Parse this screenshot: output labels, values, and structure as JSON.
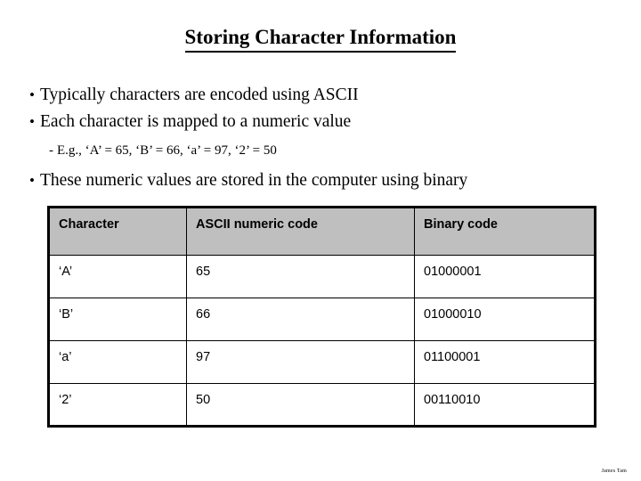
{
  "slide": {
    "title": "Storing Character Information",
    "bullets": [
      {
        "marker": "•",
        "text": "Typically characters are encoded using ASCII"
      },
      {
        "marker": "•",
        "text": "Each character is mapped to a numeric value"
      }
    ],
    "sub_bullet": {
      "marker": "-",
      "text": "E.g., ‘A’ = 65, ‘B’ = 66, ‘a’ = 97, ‘2’ = 50"
    },
    "bullet_third": {
      "marker": "•",
      "text": "These numeric values are stored in the computer using binary"
    },
    "table": {
      "headers": [
        "Character",
        "ASCII numeric code",
        "Binary code"
      ],
      "rows": [
        [
          "‘A’",
          "65",
          "01000001"
        ],
        [
          "‘B’",
          "66",
          "01000010"
        ],
        [
          "‘a’",
          "97",
          "01100001"
        ],
        [
          "‘2’",
          "50",
          "00110010"
        ]
      ],
      "header_bg": "#bfbfbf",
      "border_color": "#000000"
    },
    "footer_credit": "James Tam"
  }
}
